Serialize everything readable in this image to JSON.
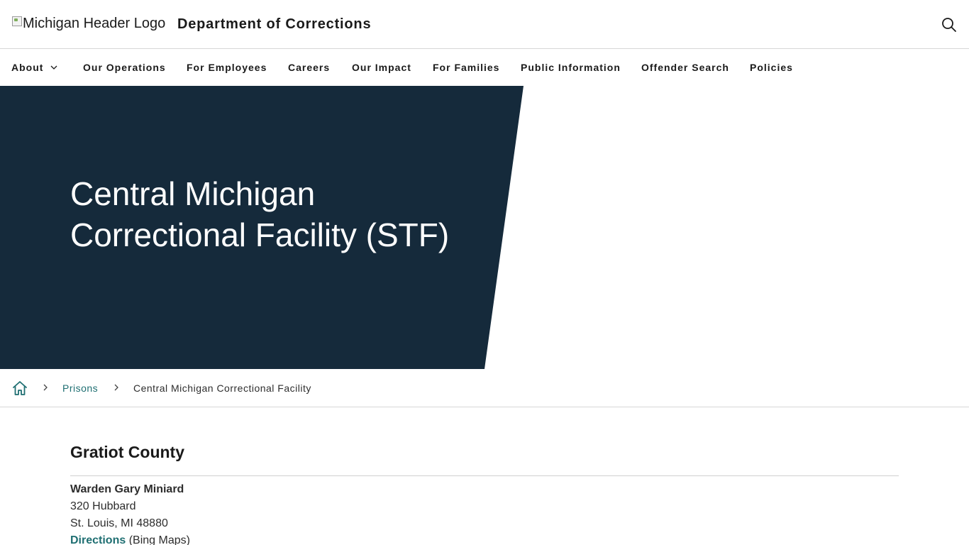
{
  "header": {
    "logo_alt": "Michigan Header Logo",
    "title": "Department of Corrections",
    "search_icon": "search-icon"
  },
  "nav": {
    "items": [
      {
        "label": "About",
        "has_dropdown": true
      },
      {
        "label": "Our Operations"
      },
      {
        "label": "For Employees"
      },
      {
        "label": "Careers"
      },
      {
        "label": "Our Impact"
      },
      {
        "label": "For Families"
      },
      {
        "label": "Public Information"
      },
      {
        "label": "Offender Search"
      },
      {
        "label": "Policies"
      }
    ]
  },
  "hero": {
    "title_line1": "Central Michigan",
    "title_line2": "Correctional Facility (STF)",
    "background_color": "#152a3b"
  },
  "breadcrumb": {
    "home_icon": "home-icon",
    "link": "Prisons",
    "current": "Central Michigan Correctional Facility"
  },
  "facility": {
    "county": "Gratiot County",
    "warden": "Warden Gary Miniard",
    "street": "320 Hubbard",
    "city_state_zip": "St. Louis, MI 48880",
    "directions_link": "Directions",
    "directions_note": "(Bing Maps)"
  },
  "colors": {
    "accent": "#1f6f72",
    "hero": "#152a3b"
  }
}
